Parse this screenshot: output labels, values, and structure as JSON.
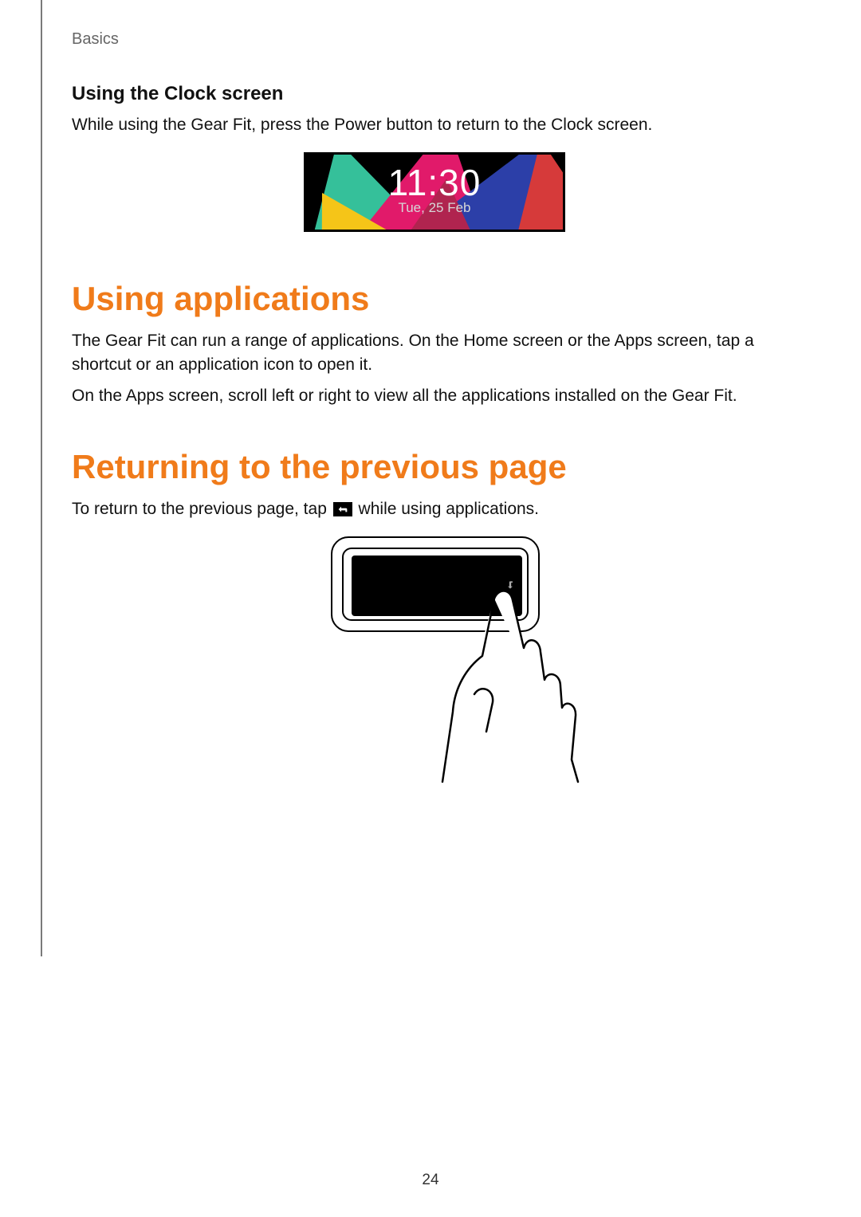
{
  "header": {
    "section": "Basics"
  },
  "section1": {
    "subheading": "Using the Clock screen",
    "body": "While using the Gear Fit, press the Power button to return to the Clock screen.",
    "clock": {
      "time": "11:30",
      "date": "Tue, 25 Feb"
    }
  },
  "section2": {
    "title": "Using applications",
    "body1": "The Gear Fit can run a range of applications. On the Home screen or the Apps screen, tap a shortcut or an application icon to open it.",
    "body2": "On the Apps screen, scroll left or right to view all the applications installed on the Gear Fit."
  },
  "section3": {
    "title": "Returning to the previous page",
    "body_pre": "To return to the previous page, tap ",
    "body_post": " while using applications."
  },
  "page_number": "24"
}
